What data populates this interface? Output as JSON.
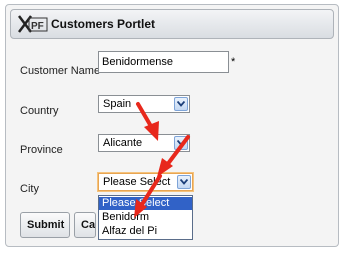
{
  "portlet": {
    "title": "Customers Portlet",
    "logo_icon": "xpf-logo-icon"
  },
  "form": {
    "customer_name": {
      "label": "Customer Name",
      "value": "Benidormense",
      "required_mark": "*"
    },
    "country": {
      "label": "Country",
      "selected": "Spain"
    },
    "province": {
      "label": "Province",
      "selected": "Alicante"
    },
    "city": {
      "label": "City",
      "selected": "Please Select",
      "options": [
        "Please Select",
        "Benidorm",
        "Alfaz del Pi"
      ],
      "highlighted_index": 0
    }
  },
  "buttons": {
    "submit": "Submit",
    "cancel": "Cancel"
  },
  "colors": {
    "annotation_arrow": "#e8281c",
    "dropdown_highlight": "#3162c7",
    "focus_border": "#e8a552"
  }
}
